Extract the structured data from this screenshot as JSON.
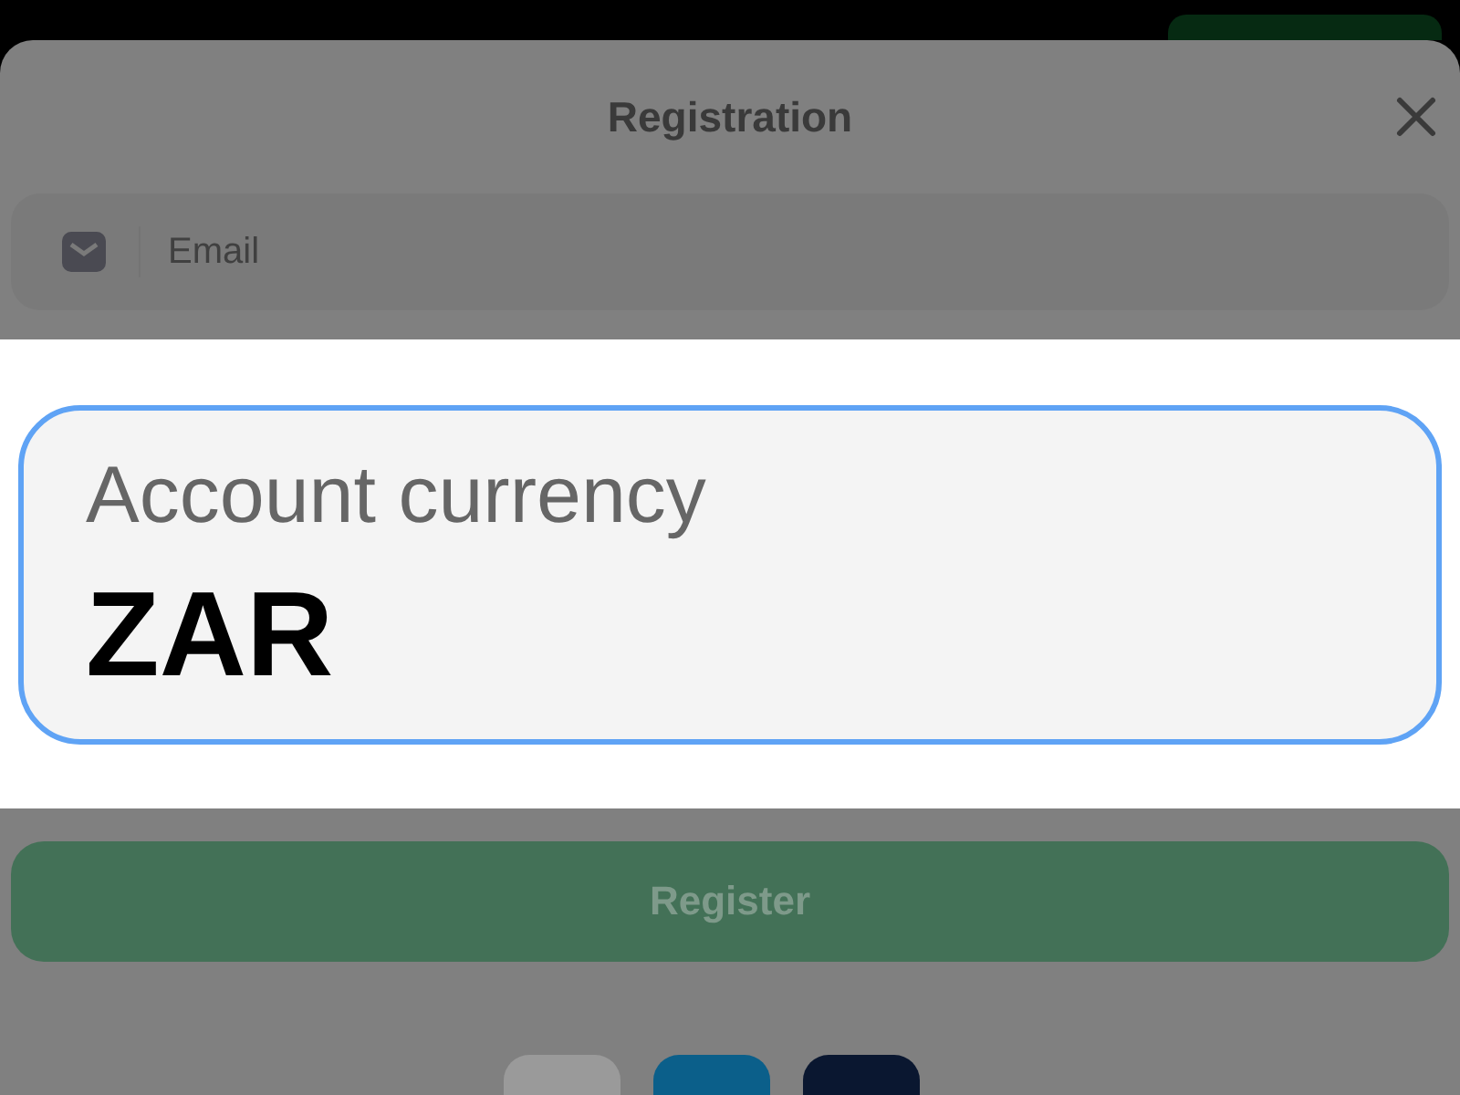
{
  "dialog": {
    "title": "Registration"
  },
  "email_field": {
    "placeholder": "Email"
  },
  "currency_field": {
    "label": "Account currency",
    "value": "ZAR",
    "focused": true
  },
  "register_button": {
    "label": "Register",
    "disabled": true
  }
}
